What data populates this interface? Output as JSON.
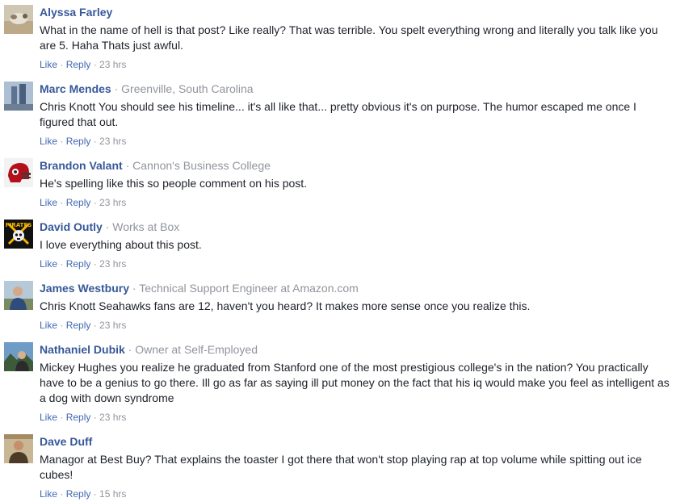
{
  "actions": {
    "like": "Like",
    "reply": "Reply",
    "dot": " · "
  },
  "comments": [
    {
      "author": "Alyssa Farley",
      "meta": "",
      "text": "What in the name of hell is that post? Like really? That was terrible. You spelt everything wrong and literally you talk like you are 5. Haha Thats just awful.",
      "time": "23 hrs"
    },
    {
      "author": "Marc Mendes",
      "meta": "Greenville, South Carolina",
      "text": "Chris Knott You should see his timeline... it's all like that... pretty obvious it's on purpose. The humor escaped me once I figured that out.",
      "time": "23 hrs"
    },
    {
      "author": "Brandon Valant",
      "meta": "Cannon's Business College",
      "text": "He's spelling like this so people comment on his post.",
      "time": "23 hrs"
    },
    {
      "author": "David Outly",
      "meta": "Works at Box",
      "text": "I love everything about this post.",
      "time": "23 hrs",
      "avatar_text": "PIRATES"
    },
    {
      "author": "James Westbury",
      "meta": "Technical Support Engineer at Amazon.com",
      "text": "Chris Knott Seahawks fans are 12, haven't you heard? It makes more sense once you realize this.",
      "time": "23 hrs"
    },
    {
      "author": "Nathaniel Dubik",
      "meta": "Owner at Self-Employed",
      "text": "Mickey Hughes you realize he graduated from Stanford one of the most prestigious college's in the nation? You practically have to be a genius to go there. Ill go as far as saying ill put money on the fact that his iq would make you feel as intelligent as a dog with down syndrome",
      "time": "23 hrs"
    },
    {
      "author": "Dave Duff",
      "meta": "",
      "text": "Managor at Best Buy? That explains the toaster I got there that won't stop playing rap at top volume while spitting out ice cubes!",
      "time": "15 hrs"
    }
  ]
}
